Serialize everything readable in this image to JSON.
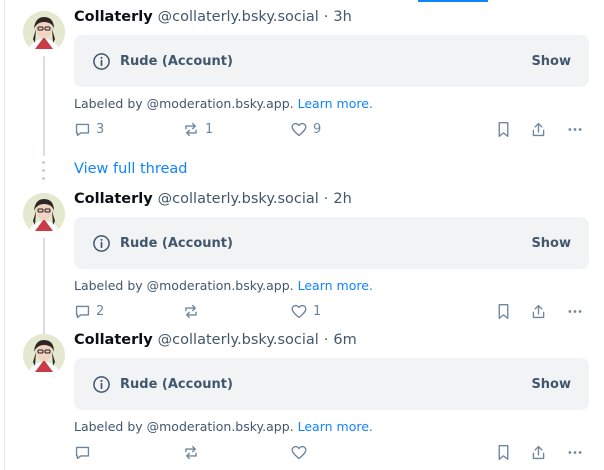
{
  "posts": [
    {
      "author": "Collaterly",
      "handle": "@collaterly.bsky.social",
      "separator": "·",
      "time": "3h",
      "label": "Rude (Account)",
      "show": "Show",
      "labeled_by_prefix": "Labeled by @moderation.bsky.app.",
      "learn_more": "Learn more.",
      "replies": "3",
      "reposts": "1",
      "likes": "9"
    },
    {
      "author": "Collaterly",
      "handle": "@collaterly.bsky.social",
      "separator": "·",
      "time": "2h",
      "label": "Rude (Account)",
      "show": "Show",
      "labeled_by_prefix": "Labeled by @moderation.bsky.app.",
      "learn_more": "Learn more.",
      "replies": "2",
      "reposts": "",
      "likes": "1"
    },
    {
      "author": "Collaterly",
      "handle": "@collaterly.bsky.social",
      "separator": "·",
      "time": "6m",
      "label": "Rude (Account)",
      "show": "Show",
      "labeled_by_prefix": "Labeled by @moderation.bsky.app.",
      "learn_more": "Learn more.",
      "replies": "",
      "reposts": "",
      "likes": ""
    }
  ],
  "view_full_thread": "View full thread",
  "icons": {
    "info": "info-circle-icon",
    "reply": "reply-bubble-icon",
    "repost": "repost-icon",
    "like": "heart-icon",
    "bookmark": "bookmark-icon",
    "share": "share-icon",
    "more": "more-horizontal-icon"
  },
  "colors": {
    "accent": "#1083fe",
    "muted": "#42576c",
    "icon": "#6f869f",
    "label_bg": "#f1f3f5"
  }
}
